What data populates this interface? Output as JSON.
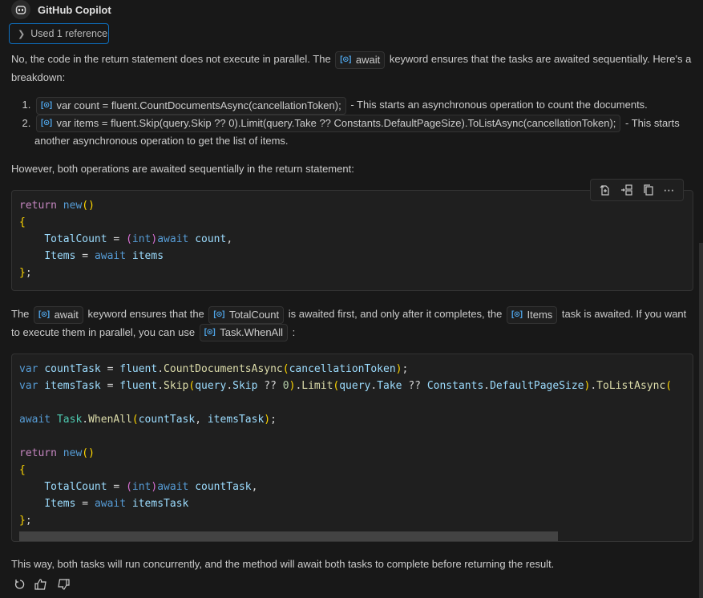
{
  "header": {
    "title": "GitHub Copilot",
    "avatar_icon": "copilot-icon"
  },
  "references": {
    "label": "Used 1 reference",
    "icon": "chevron-right-icon"
  },
  "intro": {
    "before": "No, the code in the return statement does not execute in parallel. The ",
    "chip": "await",
    "after": " keyword ensures that the tasks are awaited sequentially. Here's a breakdown:"
  },
  "list": [
    {
      "chip": "var count = fluent.CountDocumentsAsync(cancellationToken);",
      "text": " - This starts an asynchronous operation to count the documents."
    },
    {
      "chip": "var items = fluent.Skip(query.Skip ?? 0).Limit(query.Take ?? Constants.DefaultPageSize).ToListAsync(cancellationToken);",
      "text": " - This starts another asynchronous operation to get the list of items."
    }
  ],
  "however": "However, both operations are awaited sequentially in the return statement:",
  "code_toolbar": [
    {
      "name": "insert-into-file-icon",
      "label": "Insert into file"
    },
    {
      "name": "insert-at-cursor-icon",
      "label": "Insert at cursor"
    },
    {
      "name": "copy-icon",
      "label": "Copy"
    },
    {
      "name": "more-actions-icon",
      "label": "More actions"
    }
  ],
  "code1": {
    "lines": [
      "return new()",
      "{",
      "    TotalCount = (int)await count,",
      "    Items = await items",
      "};"
    ]
  },
  "explain": {
    "p1": "The ",
    "c1": "await",
    "p2": " keyword ensures that the ",
    "c2": "TotalCount",
    "p3": " is awaited first, and only after it completes, the ",
    "c3": "Items",
    "p4": " task is awaited. If you want to execute them in parallel, you can use ",
    "c4": "Task.WhenAll",
    "p5": " :"
  },
  "code2": {
    "lines": [
      "var countTask = fluent.CountDocumentsAsync(cancellationToken);",
      "var itemsTask = fluent.Skip(query.Skip ?? 0).Limit(query.Take ?? Constants.DefaultPageSize).ToListAsync(",
      "",
      "await Task.WhenAll(countTask, itemsTask);",
      "",
      "return new()",
      "{",
      "    TotalCount = (int)await countTask,",
      "    Items = await itemsTask",
      "};"
    ]
  },
  "conclusion": "This way, both tasks will run concurrently, and the method will await both tasks to complete before returning the result.",
  "actions": [
    {
      "name": "retry-icon",
      "label": "Retry"
    },
    {
      "name": "thumbs-up-icon",
      "label": "Helpful"
    },
    {
      "name": "thumbs-down-icon",
      "label": "Unhelpful"
    }
  ],
  "colors": {
    "accent": "#0e70c0",
    "symbol": "#4fa6ea",
    "background": "#181818",
    "code_bg": "#1f1f1f"
  }
}
